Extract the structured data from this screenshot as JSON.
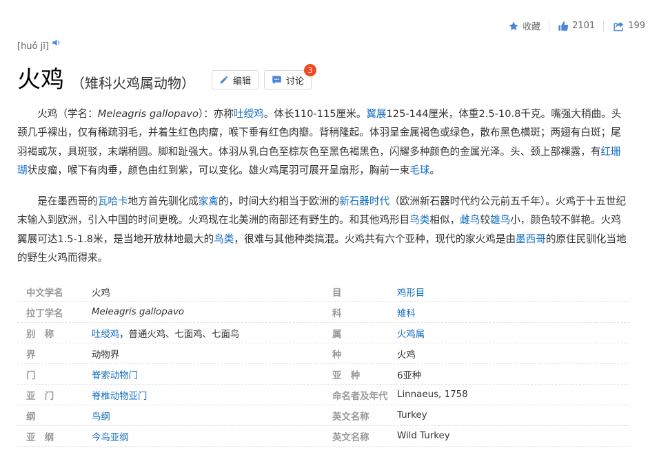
{
  "actions": {
    "collect_label": "收藏",
    "like_count": "2101",
    "share_count": "199"
  },
  "entry": {
    "pinyin": "[huǒ jī]",
    "title": "火鸡",
    "subtitle": "（雉科火鸡属动物）",
    "edit_label": "编辑",
    "discuss_label": "讨论",
    "discuss_badge": "3"
  },
  "paragraph1": {
    "t1": "火鸡（学名：",
    "latin": "Meleagris gallopavo",
    "t2": "）：亦称",
    "link1": "吐绶鸡",
    "t3": "。体长110-115厘米。",
    "link2": "翼展",
    "t4": "125-144厘米，体重2.5-10.8千克。嘴强大稍曲。头颈几乎裸出，仅有稀疏羽毛，并着生红色肉瘤，喉下垂有红色肉瓣。背稍隆起。体羽呈金属褐色或绿色，散布黑色横斑；两翅有白斑；尾羽褐或灰，具斑驳，末端稍圆。脚和趾强大。体羽从乳白色至棕灰色至黑色褐黑色，闪耀多种颜色的金属光泽。头、颈上部裸露，有",
    "link3": "红珊瑚",
    "t5": "状皮瘤，喉下有肉垂，颜色由红到紫，可以变化。雄火鸡尾羽可展开呈扇形，胸前一束",
    "link4": "毛球",
    "t6": "。"
  },
  "paragraph2": {
    "t1": "是在墨西哥的",
    "link1": "瓦哈卡",
    "t2": "地方首先驯化成",
    "link2": "家禽",
    "t3": "的，时间大约相当于欧洲的",
    "link3": "新石器时代",
    "t4": "（欧洲新石器时代约公元前五千年）。火鸡于十五世纪末输入到欧洲，引入中国的时间更晚。火鸡现在北美洲的南部还有野生的。和其他鸡形目",
    "link4": "鸟类",
    "t5": "相似，",
    "link5": "雌鸟",
    "t6": "较",
    "link6": "雄鸟",
    "t7": "小，颜色较不鲜艳。火鸡翼展可达1.5-1.8米，是当地开放林地最大的",
    "link7": "鸟类",
    "t8": "，很难与其他种类搞混。火鸡共有六个亚种，现代的家火鸡是由",
    "link8": "墨西哥",
    "t9": "的原住民驯化当地的野生火鸡而得来。"
  },
  "info_rows": [
    {
      "k1": "中文学名",
      "v1": "火鸡",
      "k2": "目",
      "v2": "鸡形目"
    },
    {
      "k1": "拉丁学名",
      "v1": "Meleagris gallopavo",
      "k2": "科",
      "v2": "雉科"
    },
    {
      "k1": "别　称",
      "v1_link": "吐绶鸡",
      "v1_rest": "，普通火鸡、七面鸡、七面鸟",
      "k2": "属",
      "v2": "火鸡属"
    },
    {
      "k1": "界",
      "v1": "动物界",
      "k2": "种",
      "v2": "火鸡"
    },
    {
      "k1": "门",
      "v1": "脊索动物门",
      "k2": "亚　种",
      "v2": "6亚种"
    },
    {
      "k1": "亚　门",
      "v1": "脊椎动物亚门",
      "k2": "命名者及年代",
      "v2": "Linnaeus, 1758"
    },
    {
      "k1": "纲",
      "v1": "鸟纲",
      "k2": "英文名称",
      "v2": "Turkey"
    },
    {
      "k1": "亚　纲",
      "v1": "今鸟亚纲",
      "k2": "英文名称",
      "v2": "Wild Turkey"
    }
  ],
  "colors": {
    "link": "#136ec2",
    "icon": "#4b86d9",
    "badge": "#f04a24",
    "label": "#999999"
  }
}
